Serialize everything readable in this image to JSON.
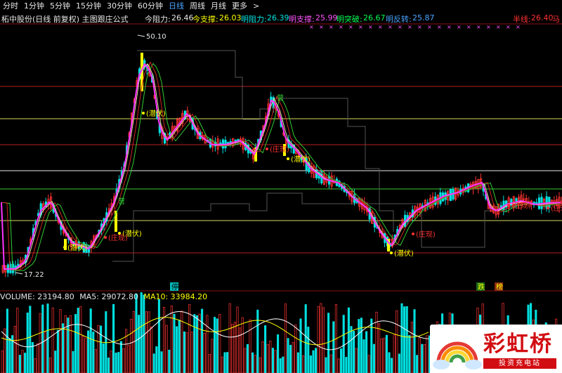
{
  "toolbar": {
    "periods": [
      "分时",
      "1分钟",
      "5分钟",
      "15分钟",
      "30分钟",
      "60分钟",
      "日线",
      "周线",
      "月线",
      "更多"
    ],
    "active": "日线",
    "more_arrow": ">"
  },
  "info": {
    "title": "柘中股份(日线 前复权) 主图跟庄公式",
    "today_resist_label": "今阻力:",
    "today_resist_value": "26.46",
    "today_support_label": "今支撑:",
    "today_support_value": "26.03",
    "tomorrow_resist_label": "明阻力:",
    "tomorrow_resist_value": "26.39",
    "tomorrow_support_label": "明支撑:",
    "tomorrow_support_value": "25.99",
    "tomorrow_break_label": "明突破:",
    "tomorrow_break_value": "26.67",
    "tomorrow_reverse_label": "明反转:",
    "tomorrow_reverse_value": "25.87",
    "half_line_label": "半线:",
    "half_line_value": "26.40",
    "trailing_label": "马"
  },
  "annotations": {
    "high_price": "50.10",
    "low_price": "17.22",
    "lurk": "(潜伏)",
    "dealer": "(庄现)",
    "camp": "营",
    "stop_mark": "停",
    "fall_mark": "跌",
    "surge_mark": "榜"
  },
  "volume": {
    "label": "VOLUME: 23194.80",
    "ma5": "MA5: 29072.80",
    "ma10": "MA10: 33984.20"
  },
  "logo": {
    "brand": "彩虹桥",
    "sub": "投资充电站"
  },
  "colors": {
    "up": "#ff3232",
    "down": "#00e0e0",
    "ma5": "#ffffff",
    "ma10": "#ffff00",
    "active_tab": "#4aa3ff"
  }
}
